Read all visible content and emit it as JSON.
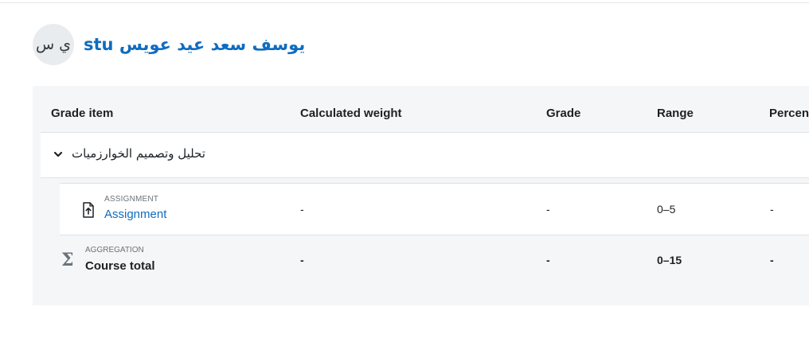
{
  "user": {
    "initials": "ي س",
    "name": "stu يوسف سعد عيد عويس"
  },
  "table": {
    "headers": {
      "grade_item": "Grade item",
      "calculated_weight": "Calculated weight",
      "grade": "Grade",
      "range": "Range",
      "percentage": "Percent"
    },
    "category": {
      "name": "تحليل وتصميم الخوارزميات",
      "icon": "chevron-down-icon"
    },
    "items": [
      {
        "type": "ASSIGNMENT",
        "name": "Assignment",
        "icon": "assignment-upload-icon",
        "calculated_weight": "-",
        "grade": "-",
        "range": "0–5",
        "percentage": "-"
      }
    ],
    "aggregation": {
      "type": "AGGREGATION",
      "name": "Course total",
      "icon": "sigma-icon",
      "calculated_weight": "-",
      "grade": "-",
      "range": "0–15",
      "percentage": "-"
    }
  },
  "colors": {
    "link": "#0f6cbf",
    "panel_background": "#f5f6f7",
    "border": "#dee2e6",
    "muted_text": "#6a737b"
  }
}
